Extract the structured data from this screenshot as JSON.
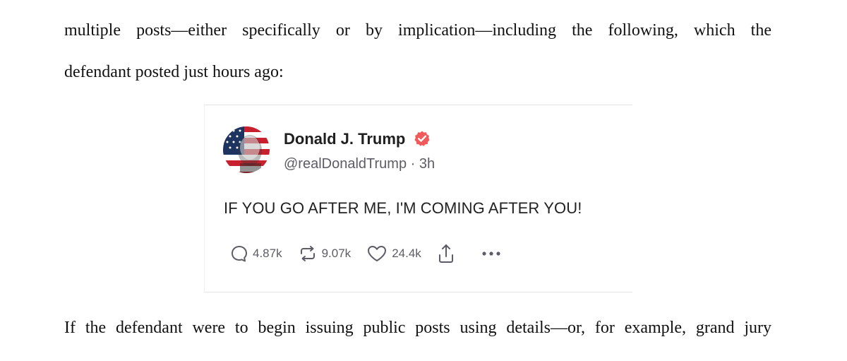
{
  "document": {
    "line1": "multiple posts—either specifically or by implication—including the following, which the",
    "line2": "defendant posted just hours ago:",
    "line3": "If the defendant were to begin issuing public posts using details—or, for example, grand jury"
  },
  "post": {
    "author_name": "Donald J. Trump",
    "handle": "@realDonaldTrump",
    "separator": "·",
    "time": "3h",
    "text": "IF YOU GO AFTER ME, I'M COMING AFTER YOU!",
    "replies": "4.87k",
    "reposts": "9.07k",
    "likes": "24.4k",
    "icons": {
      "verified": "verified-badge-icon",
      "reply": "reply-icon",
      "repost": "repost-icon",
      "like": "heart-icon",
      "share": "share-icon",
      "more": "more-options-icon"
    },
    "colors": {
      "verified": "#f05a5a",
      "action_gray": "#5c5c66"
    }
  }
}
